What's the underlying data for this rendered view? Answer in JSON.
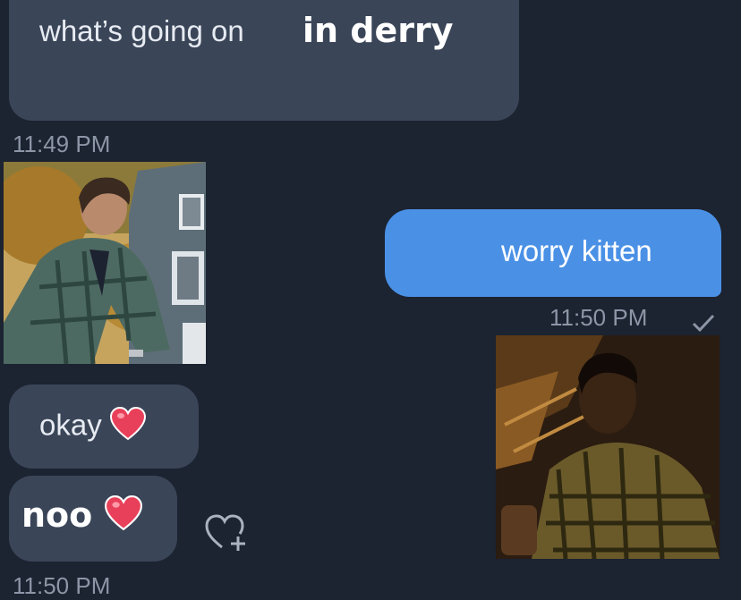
{
  "messages": {
    "first": {
      "text": "what’s going on",
      "overlay": "in derry",
      "time": "11:49 PM"
    },
    "sent": {
      "text": "worry kitten",
      "time": "11:50 PM",
      "status_icon": "check-icon"
    },
    "okay": {
      "text": "okay",
      "emoji": "heart-icon"
    },
    "noo": {
      "text": "noo",
      "emoji": "heart-icon"
    },
    "last_time": "11:50 PM"
  },
  "reaction": {
    "icon": "add-reaction-icon"
  },
  "photos": [
    {
      "name": "man-on-bike-photo",
      "subject": "man-in-plaid-shirt"
    },
    {
      "name": "man-with-flashlight-photo",
      "subject": "man-in-plaid-shirt-dark"
    }
  ],
  "colors": {
    "background": "#1c2331",
    "incoming_bubble": "#3a4558",
    "outgoing_bubble": "#4a91e6",
    "timestamp": "#8d96a6",
    "heart": "#e8405a"
  }
}
